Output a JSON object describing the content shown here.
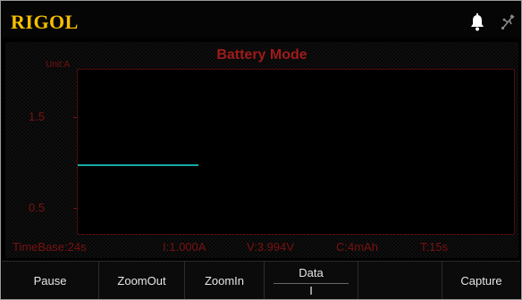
{
  "header": {
    "brand": "RIGOL",
    "icons": [
      "bell-icon",
      "usb-icon"
    ]
  },
  "panel": {
    "title": "Battery Mode",
    "unit_label": "Unit:A",
    "y_ticks": [
      "1.5",
      "0.5"
    ],
    "status": {
      "timebase": "TimeBase:24s",
      "current": "I:1.000A",
      "voltage": "V:3.994V",
      "capacity": "C:4mAh",
      "time": "T:15s"
    }
  },
  "softkeys": {
    "pause": "Pause",
    "zoom_out": "ZoomOut",
    "zoom_in": "ZoomIn",
    "data_label": "Data",
    "data_value": "I",
    "capture": "Capture"
  },
  "colors": {
    "brand": "#f6c000",
    "title": "#a01a1a",
    "axis_text": "#7a1212",
    "trace": "#16a8a8"
  }
}
